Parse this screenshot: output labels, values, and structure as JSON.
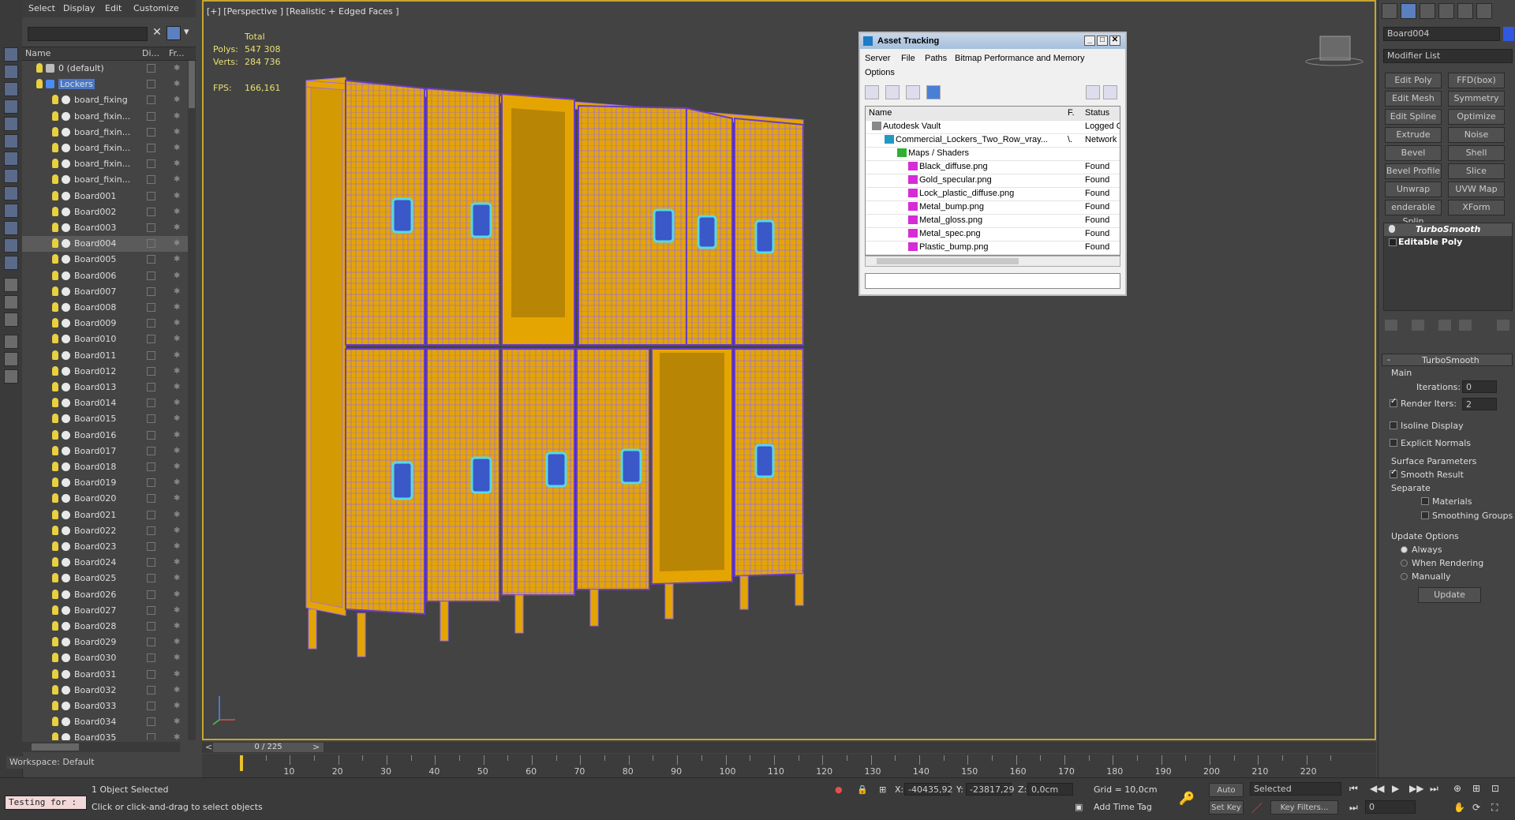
{
  "menu": {
    "select": "Select",
    "display": "Display",
    "edit": "Edit",
    "customize": "Customize"
  },
  "scene_explorer": {
    "col_name": "Name",
    "col_di": "Di...",
    "col_fr": "Fr...",
    "rows": [
      {
        "label": "0 (default)",
        "type": "layer"
      },
      {
        "label": "Lockers",
        "type": "layer",
        "selected": true
      },
      {
        "label": "board_fixing",
        "type": "obj"
      },
      {
        "label": "board_fixin...",
        "type": "obj"
      },
      {
        "label": "board_fixin...",
        "type": "obj"
      },
      {
        "label": "board_fixin...",
        "type": "obj"
      },
      {
        "label": "board_fixin...",
        "type": "obj"
      },
      {
        "label": "board_fixin...",
        "type": "obj"
      },
      {
        "label": "Board001",
        "type": "obj"
      },
      {
        "label": "Board002",
        "type": "obj"
      },
      {
        "label": "Board003",
        "type": "obj"
      },
      {
        "label": "Board004",
        "type": "obj",
        "highlight": true
      },
      {
        "label": "Board005",
        "type": "obj"
      },
      {
        "label": "Board006",
        "type": "obj"
      },
      {
        "label": "Board007",
        "type": "obj"
      },
      {
        "label": "Board008",
        "type": "obj"
      },
      {
        "label": "Board009",
        "type": "obj"
      },
      {
        "label": "Board010",
        "type": "obj"
      },
      {
        "label": "Board011",
        "type": "obj"
      },
      {
        "label": "Board012",
        "type": "obj"
      },
      {
        "label": "Board013",
        "type": "obj"
      },
      {
        "label": "Board014",
        "type": "obj"
      },
      {
        "label": "Board015",
        "type": "obj"
      },
      {
        "label": "Board016",
        "type": "obj"
      },
      {
        "label": "Board017",
        "type": "obj"
      },
      {
        "label": "Board018",
        "type": "obj"
      },
      {
        "label": "Board019",
        "type": "obj"
      },
      {
        "label": "Board020",
        "type": "obj"
      },
      {
        "label": "Board021",
        "type": "obj"
      },
      {
        "label": "Board022",
        "type": "obj"
      },
      {
        "label": "Board023",
        "type": "obj"
      },
      {
        "label": "Board024",
        "type": "obj"
      },
      {
        "label": "Board025",
        "type": "obj"
      },
      {
        "label": "Board026",
        "type": "obj"
      },
      {
        "label": "Board027",
        "type": "obj"
      },
      {
        "label": "Board028",
        "type": "obj"
      },
      {
        "label": "Board029",
        "type": "obj"
      },
      {
        "label": "Board030",
        "type": "obj"
      },
      {
        "label": "Board031",
        "type": "obj"
      },
      {
        "label": "Board032",
        "type": "obj"
      },
      {
        "label": "Board033",
        "type": "obj"
      },
      {
        "label": "Board034",
        "type": "obj"
      },
      {
        "label": "Board035",
        "type": "obj"
      }
    ]
  },
  "viewport": {
    "label": "[+] [Perspective ] [Realistic + Edged Faces ]",
    "total": "Total",
    "polys_label": "Polys:",
    "polys": "547 308",
    "verts_label": "Verts:",
    "verts": "284 736",
    "fps_label": "FPS:",
    "fps": "166,161"
  },
  "asset": {
    "title": "Asset Tracking",
    "menu": [
      "Server",
      "File",
      "Paths",
      "Bitmap Performance and Memory",
      "Options"
    ],
    "col_name": "Name",
    "col_f": "F.",
    "col_status": "Status",
    "rows": [
      {
        "name": "Autodesk Vault",
        "f": "",
        "status": "Logged O"
      },
      {
        "name": "Commercial_Lockers_Two_Row_vray...",
        "f": "\\.",
        "status": "Network"
      },
      {
        "name": "Maps / Shaders",
        "f": "",
        "status": ""
      },
      {
        "name": "Black_diffuse.png",
        "f": "",
        "status": "Found"
      },
      {
        "name": "Gold_specular.png",
        "f": "",
        "status": "Found"
      },
      {
        "name": "Lock_plastic_diffuse.png",
        "f": "",
        "status": "Found"
      },
      {
        "name": "Metal_bump.png",
        "f": "",
        "status": "Found"
      },
      {
        "name": "Metal_gloss.png",
        "f": "",
        "status": "Found"
      },
      {
        "name": "Metal_spec.png",
        "f": "",
        "status": "Found"
      },
      {
        "name": "Plastic_bump.png",
        "f": "",
        "status": "Found"
      }
    ]
  },
  "cmd": {
    "object_name": "Board004",
    "modifier_list": "Modifier List",
    "buttons": [
      "Edit Poly",
      "FFD(box)",
      "Edit Mesh",
      "Symmetry",
      "Edit Spline",
      "Optimize",
      "Extrude",
      "Noise",
      "Bevel",
      "Shell",
      "Bevel Profile",
      "Slice",
      "Unwrap UVW",
      "UVW Map",
      "enderable Splin",
      "XForm"
    ],
    "stack": [
      "TurboSmooth",
      "Editable Poly"
    ],
    "rollout_title": "TurboSmooth",
    "main": "Main",
    "iterations_label": "Iterations:",
    "iterations": "0",
    "render_iters_label": "Render Iters:",
    "render_iters": "2",
    "isoline": "Isoline Display",
    "explicit": "Explicit Normals",
    "surface": "Surface Parameters",
    "smooth_result": "Smooth Result",
    "separate": "Separate",
    "materials": "Materials",
    "smoothing_groups": "Smoothing Groups",
    "update_options": "Update Options",
    "always": "Always",
    "when_rendering": "When Rendering",
    "manually": "Manually",
    "update": "Update"
  },
  "timeline": {
    "frame": "0 / 225",
    "ticks": [
      "10",
      "20",
      "30",
      "40",
      "50",
      "60",
      "70",
      "80",
      "90",
      "100",
      "110",
      "120",
      "130",
      "140",
      "150",
      "160",
      "170",
      "180",
      "190",
      "200",
      "210",
      "220"
    ]
  },
  "status": {
    "workspace": "Workspace: Default",
    "script": "Testing for :",
    "selected": "1 Object Selected",
    "hint": "Click or click-and-drag to select objects",
    "x_label": "X:",
    "x": "-40435,92",
    "y_label": "Y:",
    "y": "-23817,29",
    "z_label": "Z:",
    "z": "0,0cm",
    "grid": "Grid = 10,0cm",
    "add_time_tag": "Add Time Tag",
    "auto_key": "Auto Key",
    "set_key": "Set Key",
    "selected_dropdown": "Selected",
    "key_filters": "Key Filters...",
    "frame_input": "0"
  },
  "colors": {
    "locker": "#e4a502",
    "wire": "#9a6cf0",
    "lock": "#58d8e8",
    "accent": "#c7a52e"
  }
}
